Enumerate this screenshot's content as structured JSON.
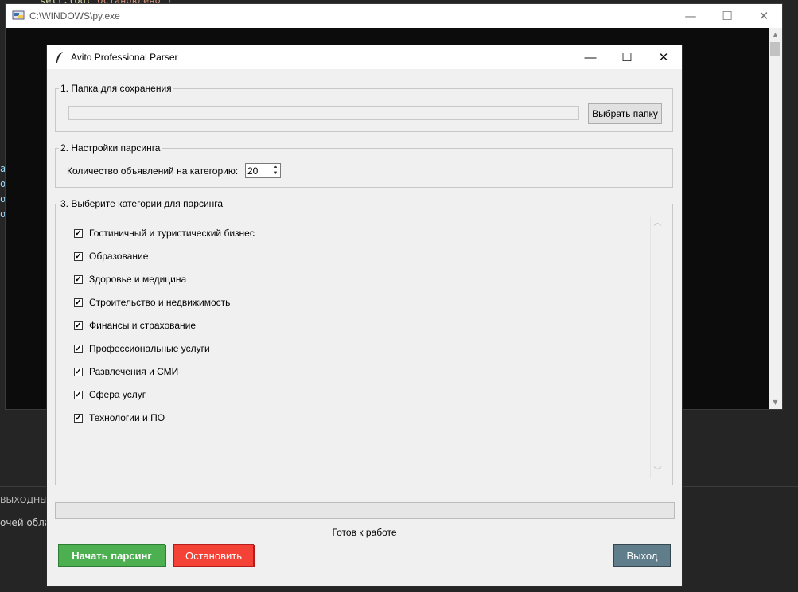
{
  "background": {
    "code_prefix": "self.log(",
    "code_string": "\"Остановлено\")",
    "panel_title": "ВЫХОДНЫЕ ДАННЫЕ",
    "panel_text": "очей области",
    "side_letters": [
      "а",
      "о",
      "о",
      "о"
    ]
  },
  "console": {
    "title": "C:\\WINDOWS\\py.exe",
    "icon": "python-console-icon"
  },
  "window": {
    "title": "Avito Professional Parser",
    "icon": "feather-icon",
    "controls": {
      "minimize": "—",
      "maximize": "☐",
      "close": "✕"
    }
  },
  "folder_section": {
    "legend": "1. Папка для сохранения",
    "path_value": "",
    "browse_label": "Выбрать папку"
  },
  "settings_section": {
    "legend": "2. Настройки парсинга",
    "count_label": "Количество объявлений на категорию:",
    "count_value": "20"
  },
  "categories_section": {
    "legend": "3. Выберите категории для парсинга",
    "items": [
      {
        "label": "Гостиничный и туристический бизнес",
        "checked": true
      },
      {
        "label": "Образование",
        "checked": true
      },
      {
        "label": "Здоровье и медицина",
        "checked": true
      },
      {
        "label": "Строительство и недвижимость",
        "checked": true
      },
      {
        "label": "Финансы и страхование",
        "checked": true
      },
      {
        "label": "Профессиональные услуги",
        "checked": true
      },
      {
        "label": "Развлечения и СМИ",
        "checked": true
      },
      {
        "label": "Сфера услуг",
        "checked": true
      },
      {
        "label": "Технологии и ПО",
        "checked": true
      }
    ]
  },
  "progress": {
    "value_percent": 0
  },
  "status_text": "Готов к работе",
  "buttons": {
    "start": "Начать парсинг",
    "stop": "Остановить",
    "exit": "Выход"
  },
  "colors": {
    "start": "#4caf50",
    "stop": "#f44336",
    "exit": "#607d8b"
  }
}
